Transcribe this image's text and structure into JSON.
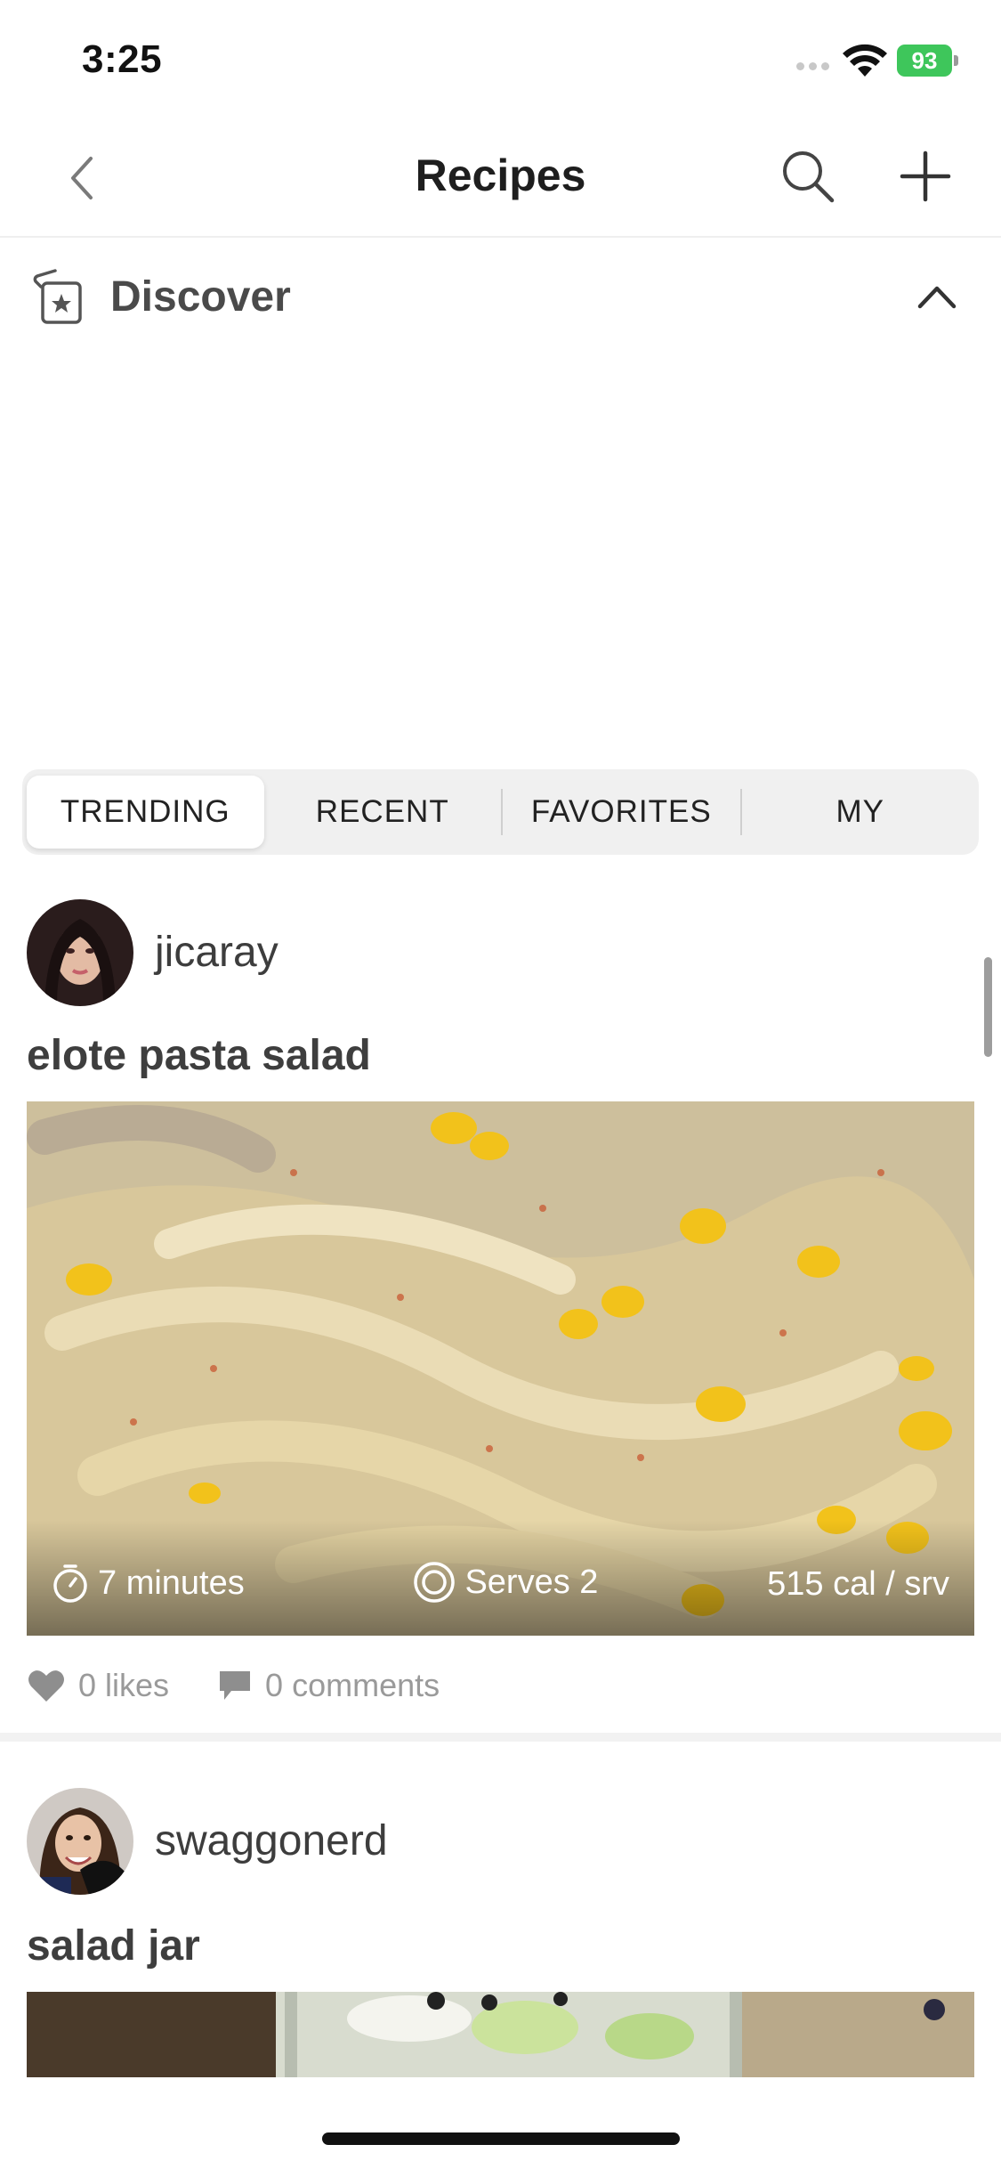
{
  "status_bar": {
    "time": "3:25",
    "battery": "93"
  },
  "nav": {
    "title": "Recipes"
  },
  "discover": {
    "label": "Discover"
  },
  "tabs": [
    {
      "label": "TRENDING",
      "active": true
    },
    {
      "label": "RECENT",
      "active": false
    },
    {
      "label": "FAVORITES",
      "active": false
    },
    {
      "label": "MY",
      "active": false
    }
  ],
  "posts": [
    {
      "username": "jicaray",
      "title": "elote pasta salad",
      "time": "7 minutes",
      "serves": "Serves 2",
      "calories": "515 cal / srv",
      "likes": "0 likes",
      "comments": "0 comments"
    },
    {
      "username": "swaggonerd",
      "title": "salad jar"
    }
  ],
  "colors": {
    "battery": "#3ec65b",
    "active_tab_bg": "#ffffff",
    "segment_bg": "#f0f0f0"
  }
}
